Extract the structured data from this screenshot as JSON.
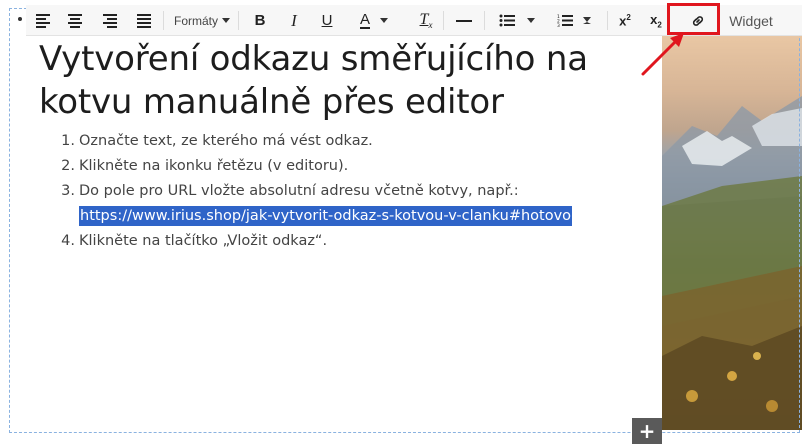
{
  "toolbar": {
    "format_label": "Formáty",
    "bold_label": "B",
    "italic_label": "I",
    "underline_label": "U",
    "font_color_label": "A",
    "clear_format_label": "T",
    "clear_format_sub": "x",
    "superscript_label": "x",
    "superscript_mark": "2",
    "subscript_label": "x",
    "subscript_mark": "2",
    "widget_label": "Widget",
    "accent_color": "#e0161e"
  },
  "content": {
    "heading": "Vytvoření odkazu směřujícího na kotvu manuálně přes editor",
    "steps": [
      {
        "number": "1.",
        "text": "Označte text, ze kterého má vést odkaz."
      },
      {
        "number": "2.",
        "text": "Klikněte na ikonku řetězu (v editoru)."
      },
      {
        "number": "3.",
        "text": "Do pole pro URL vložte absolutní adresu včetně kotvy, např.:",
        "url": "https://www.irius.shop/jak-vytvorit-odkaz-s-kotvou-v-clanku#hotovo"
      },
      {
        "number": "4.",
        "text": "Klikněte na tlačítko „Vložit odkaz“."
      }
    ]
  },
  "plus_label": "+"
}
